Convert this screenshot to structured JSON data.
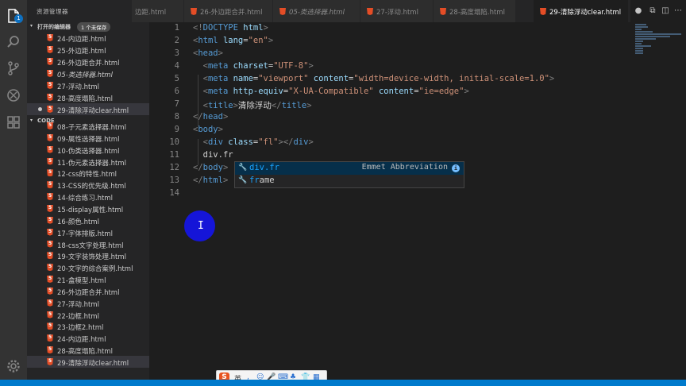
{
  "sidebar": {
    "title": "资源管理器",
    "open_editors": {
      "label": "打开的编辑器",
      "badge": "1 个未保存"
    },
    "open_files": [
      {
        "name": "24-内边距.html",
        "italic": false,
        "dirty": false
      },
      {
        "name": "25-外边距.html",
        "italic": false,
        "dirty": false
      },
      {
        "name": "26-外边距合并.html",
        "italic": false,
        "dirty": false
      },
      {
        "name": "05-类选择器.html",
        "italic": true,
        "dirty": false
      },
      {
        "name": "27-浮动.html",
        "italic": false,
        "dirty": false
      },
      {
        "name": "28-高度塌陷.html",
        "italic": false,
        "dirty": false
      },
      {
        "name": "29-清除浮动clear.html",
        "italic": false,
        "dirty": true
      }
    ],
    "code_section": {
      "label": "CODE"
    },
    "code_files": [
      {
        "name": "08-子元素选择器.html"
      },
      {
        "name": "09-属性选择器.html"
      },
      {
        "name": "10-伪类选择器.html"
      },
      {
        "name": "11-伪元素选择器.html"
      },
      {
        "name": "12-css的特性.html"
      },
      {
        "name": "13-CSS的优先级.html"
      },
      {
        "name": "14-综合练习.html"
      },
      {
        "name": "15-display属性.html"
      },
      {
        "name": "16-颜色.html"
      },
      {
        "name": "17-字体排版.html"
      },
      {
        "name": "18-css文字处理.html"
      },
      {
        "name": "19-文字装饰处理.html"
      },
      {
        "name": "20-文字的综合案例.html"
      },
      {
        "name": "21-盒模型.html"
      },
      {
        "name": "26-外边距合并.html"
      },
      {
        "name": "27-浮动.html"
      },
      {
        "name": "22-边框.html"
      },
      {
        "name": "23-边框2.html"
      },
      {
        "name": "24-内边距.html"
      },
      {
        "name": "28-高度塌陷.html"
      },
      {
        "name": "29-清除浮动clear.html"
      }
    ],
    "activity_badge": "1"
  },
  "tabs": [
    {
      "label": "边距.html",
      "italic": false,
      "active": false
    },
    {
      "label": "26-外边距合并.html",
      "italic": false,
      "active": false
    },
    {
      "label": "05-类选择器.html",
      "italic": true,
      "active": false
    },
    {
      "label": "27-浮动.html",
      "italic": false,
      "active": false
    },
    {
      "label": "28-高度塌陷.html",
      "italic": false,
      "active": false
    },
    {
      "label": "29-清除浮动clear.html",
      "italic": false,
      "active": true
    }
  ],
  "editor": {
    "line_numbers": [
      "1",
      "2",
      "3",
      "4",
      "5",
      "6",
      "7",
      "8",
      "9",
      "10",
      "11",
      "12",
      "13",
      "14"
    ],
    "suggest": {
      "items": [
        {
          "prefix": "div.fr",
          "rest": "",
          "detail": "Emmet Abbreviation",
          "selected": true
        },
        {
          "prefix": "fr",
          "rest": "ame",
          "detail": "",
          "selected": false
        }
      ],
      "info": "i"
    }
  },
  "ime": {
    "lang": "英",
    "logo": "S"
  },
  "colors": {
    "accent": "#007acc",
    "html_icon": "#e44d26",
    "cursor_highlight": "#1515d8"
  }
}
